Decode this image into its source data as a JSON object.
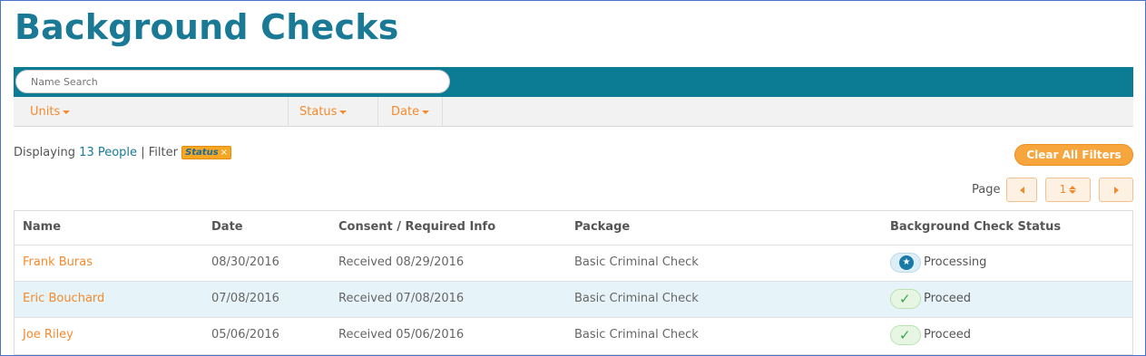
{
  "page": {
    "title": "Background Checks"
  },
  "search": {
    "placeholder": "Name Search"
  },
  "filters": {
    "units": "Units",
    "status": "Status",
    "date": "Date"
  },
  "summary": {
    "prefix": "Displaying",
    "count_text": "13 People",
    "separator": "|",
    "filter_label": "Filter",
    "active_filter": "Status",
    "remove_glyph": "×"
  },
  "actions": {
    "clear_all": "Clear All Filters"
  },
  "pager": {
    "label": "Page",
    "current": "1"
  },
  "table": {
    "columns": [
      "Name",
      "Date",
      "Consent / Required Info",
      "Package",
      "Background Check Status"
    ],
    "rows": [
      {
        "name": "Frank Buras",
        "date": "08/30/2016",
        "consent": "Received 08/29/2016",
        "package": "Basic Criminal Check",
        "status": "Processing",
        "status_icon": "star-icon"
      },
      {
        "name": "Eric Bouchard",
        "date": "07/08/2016",
        "consent": "Received 07/08/2016",
        "package": "Basic Criminal Check",
        "status": "Proceed",
        "status_icon": "check-icon"
      },
      {
        "name": "Joe Riley",
        "date": "05/06/2016",
        "consent": "Received 05/06/2016",
        "package": "Basic Criminal Check",
        "status": "Proceed",
        "status_icon": "check-icon"
      }
    ]
  },
  "colors": {
    "accent_teal": "#0c7b94",
    "title_teal": "#1a7a96",
    "orange": "#f58a2c",
    "row_highlight": "#e6f3f8"
  }
}
